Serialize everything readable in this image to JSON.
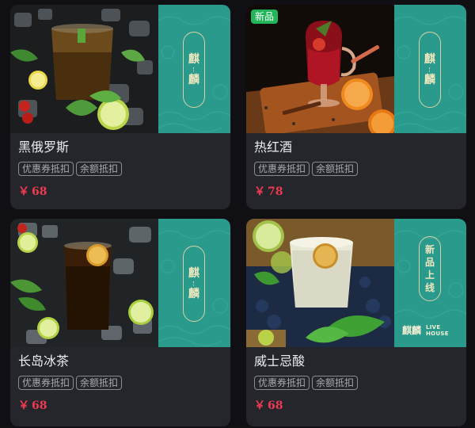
{
  "colors": {
    "background": "#101014",
    "card": "#25262b",
    "brand_panel": "#2a9a8d",
    "price": "#ee3a52",
    "new_badge": "#22b55a"
  },
  "products": [
    {
      "name": "黑俄罗斯",
      "tags": [
        "优惠券抵扣",
        "余额抵扣"
      ],
      "currency": "￥",
      "price": "68",
      "brand_seal": [
        "麒",
        "麟"
      ]
    },
    {
      "badge": "新品",
      "name": "热红酒",
      "tags": [
        "优惠券抵扣",
        "余额抵扣"
      ],
      "currency": "￥",
      "price": "78",
      "brand_seal": [
        "麒",
        "麟"
      ]
    },
    {
      "name": "长岛冰茶",
      "tags": [
        "优惠券抵扣",
        "余额抵扣"
      ],
      "currency": "￥",
      "price": "68",
      "brand_seal": [
        "麒",
        "麟"
      ]
    },
    {
      "name": "威士忌酸",
      "tags": [
        "优惠券抵扣",
        "余额抵扣"
      ],
      "currency": "￥",
      "price": "68",
      "brand_seal": [
        "新",
        "品",
        "上",
        "线"
      ],
      "brand_logo": "麒麟",
      "brand_logo_en": [
        "LIVE",
        "HOUSE"
      ]
    }
  ]
}
